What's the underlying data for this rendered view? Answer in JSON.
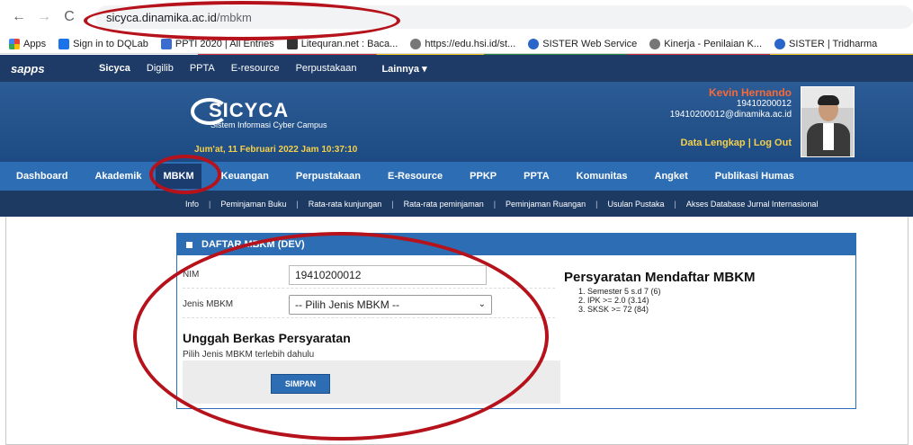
{
  "browser": {
    "back": "←",
    "forward": "→",
    "reload": "C",
    "url_host": "sicyca.dinamika.ac.id",
    "url_path": "/mbkm",
    "bookmarks": [
      "Apps",
      "Sign in to DQLab",
      "PPTI 2020 | All Entries",
      "Litequran.net : Baca...",
      "https://edu.hsi.id/st...",
      "SISTER Web Service",
      "Kinerja - Penilaian K...",
      "SISTER | Tridharma"
    ]
  },
  "topbar": {
    "logo": "sapps",
    "items": [
      "Sicyca",
      "Digilib",
      "PPTA",
      "E-resource",
      "Perpustakaan",
      "Lainnya ▾"
    ]
  },
  "header": {
    "title": "SICYCA",
    "subtitle": "Sistem Informasi Cyber Campus",
    "date": "Jum'at, 11 Februari 2022   Jam 10:37:10",
    "user_name": "Kevin Hernando",
    "user_nim": "19410200012",
    "user_email": "19410200012@dinamika.ac.id",
    "links": "Data Lengkap | Log Out"
  },
  "mainmenu": [
    "Dashboard",
    "Akademik",
    "MBKM",
    "Keuangan",
    "Perpustakaan",
    "E-Resource",
    "PPKP",
    "PPTA",
    "Komunitas",
    "Angket",
    "Publikasi Humas"
  ],
  "submenu": [
    "Info",
    "Peminjaman Buku",
    "Rata-rata kunjungan",
    "Rata-rata peminjaman",
    "Peminjaman Ruangan",
    "Usulan Pustaka",
    "Akses Database Jurnal Internasional"
  ],
  "panel": {
    "title": "DAFTAR MBKM (DEV)",
    "nim_label": "NIM",
    "nim_value": "19410200012",
    "jenis_label": "Jenis MBKM",
    "jenis_value": "-- Pilih Jenis MBKM --",
    "upload_title": "Unggah Berkas Persyaratan",
    "upload_note": "Pilih Jenis MBKM terlebih dahulu",
    "save_label": "SIMPAN",
    "req_title": "Persyaratan Mendaftar MBKM",
    "requirements": [
      "1. Semester 5 s.d 7 (6)",
      "2. IPK >= 2.0 (3.14)",
      "3. SKSK >= 72 (84)"
    ]
  }
}
